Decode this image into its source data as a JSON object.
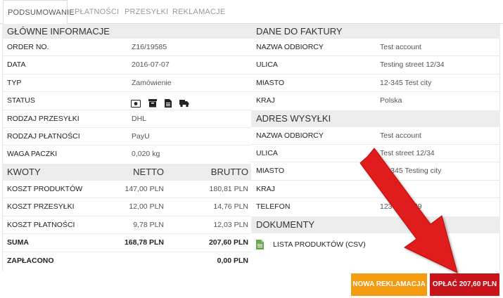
{
  "tabs": [
    {
      "label": "PODSUMOWANIE",
      "active": true
    },
    {
      "label": "PŁATNOŚCI",
      "active": false
    },
    {
      "label": "PRZESYŁKI",
      "active": false
    },
    {
      "label": "REKLAMACJE",
      "active": false
    }
  ],
  "main_info": {
    "title": "GŁÓWNE INFORMACJE",
    "rows": [
      {
        "label": "ORDER NO.",
        "value": "Z16/19585"
      },
      {
        "label": "DATA",
        "value": "2016-07-07"
      },
      {
        "label": "TYP",
        "value": "Zamówienie"
      },
      {
        "label": "STATUS",
        "value": ""
      },
      {
        "label": "RODZAJ PRZESYŁKI",
        "value": "DHL"
      },
      {
        "label": "RODZAJ PŁATNOŚCI",
        "value": "PayU"
      },
      {
        "label": "WAGA PACZKI",
        "value": "0,020 kg"
      }
    ],
    "status_icons": [
      "money-icon",
      "package-icon",
      "document-icon",
      "truck-icon"
    ]
  },
  "amounts": {
    "title": "KWOTY",
    "col_net": "NETTO",
    "col_gross": "BRUTTO",
    "rows": [
      {
        "label": "KOSZT PRODUKTÓW",
        "net": "147,00 PLN",
        "gross": "180,81 PLN",
        "bold": false
      },
      {
        "label": "KOSZT PRZESYŁKI",
        "net": "12,00 PLN",
        "gross": "14,76 PLN",
        "bold": false
      },
      {
        "label": "KOSZT PŁATNOŚCI",
        "net": "9,78 PLN",
        "gross": "12,03 PLN",
        "bold": false
      },
      {
        "label": "SUMA",
        "net": "168,78 PLN",
        "gross": "207,60 PLN",
        "bold": true
      },
      {
        "label": "ZAPŁACONO",
        "net": "",
        "gross": "0,00 PLN",
        "bold": true
      }
    ]
  },
  "invoice": {
    "title": "DANE DO FAKTURY",
    "rows": [
      {
        "label": "NAZWA ODBIORCY",
        "value": "Test account"
      },
      {
        "label": "ULICA",
        "value": "Testing street 12/34"
      },
      {
        "label": "MIASTO",
        "value": "12-345 Test city"
      },
      {
        "label": "KRAJ",
        "value": "Polska"
      }
    ]
  },
  "shipping": {
    "title": "ADRES WYSYŁKI",
    "rows": [
      {
        "label": "NAZWA ODBIORCY",
        "value": "Test account"
      },
      {
        "label": "ULICA",
        "value": "Test street 12/34"
      },
      {
        "label": "MIASTO",
        "value": "12-345 Testing city"
      },
      {
        "label": "KRAJ",
        "value": "Polska"
      },
      {
        "label": "TELEFON",
        "value": "123-456-789"
      }
    ]
  },
  "documents": {
    "title": "DOKUMENTY",
    "file_label": "LISTA PRODUKTÓW (CSV)"
  },
  "actions": {
    "complaint_label": "NOWA REKLAMACJA",
    "pay_label": "OPŁAĆ 207,60 PLN"
  },
  "colors": {
    "orange": "#f39c12",
    "red": "#c9131b",
    "arrow_red": "#e01b1b",
    "section_bg": "#ececec"
  }
}
